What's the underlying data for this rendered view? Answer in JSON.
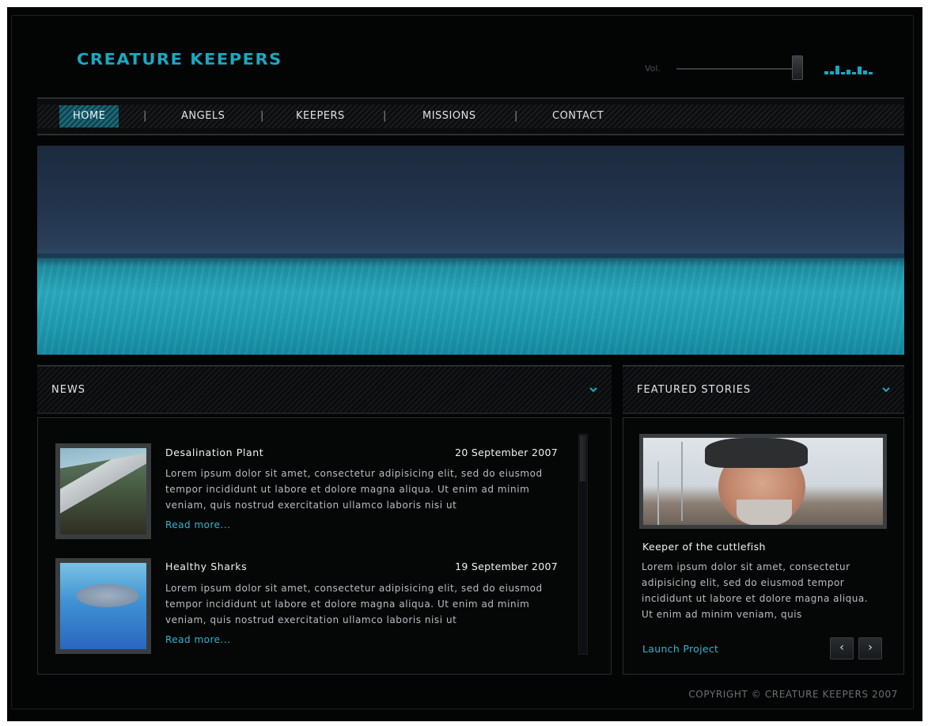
{
  "brand": {
    "logo": "CREATURE KEEPERS",
    "accent": "#18a9c4"
  },
  "volume": {
    "label": "Vol.",
    "level": 0.97
  },
  "nav": {
    "items": [
      {
        "label": "HOME",
        "active": true
      },
      {
        "label": "ANGELS"
      },
      {
        "label": "KEEPERS"
      },
      {
        "label": "MISSIONS"
      },
      {
        "label": "CONTACT"
      }
    ],
    "separator": "|"
  },
  "news": {
    "title": "NEWS",
    "items": [
      {
        "title": "Desalination Plant",
        "date": "20 September 2007",
        "text": "Lorem ipsum dolor sit amet, consectetur adipisicing elit, sed do eiusmod tempor incididunt ut labore et dolore magna aliqua. Ut enim ad minim veniam, quis nostrud exercitation ullamco laboris nisi ut",
        "link": "Read more..."
      },
      {
        "title": "Healthy Sharks",
        "date": "19 September 2007",
        "text": "Lorem ipsum dolor sit amet, consectetur adipisicing elit, sed do eiusmod tempor incididunt ut labore et dolore magna aliqua. Ut enim ad minim veniam, quis nostrud exercitation ullamco laboris nisi ut",
        "link": "Read more..."
      }
    ]
  },
  "featured": {
    "title": "FEATURED STORIES",
    "story_title": "Keeper of the cuttlefish",
    "text": "Lorem ipsum dolor sit amet, consectetur adipisicing elit, sed do eiusmod tempor incididunt ut labore et dolore magna aliqua. Ut enim ad minim veniam, quis",
    "link": "Launch Project",
    "prev": "‹",
    "next": "›"
  },
  "footer": {
    "copyright": "COPYRIGHT © CREATURE KEEPERS 2007"
  }
}
